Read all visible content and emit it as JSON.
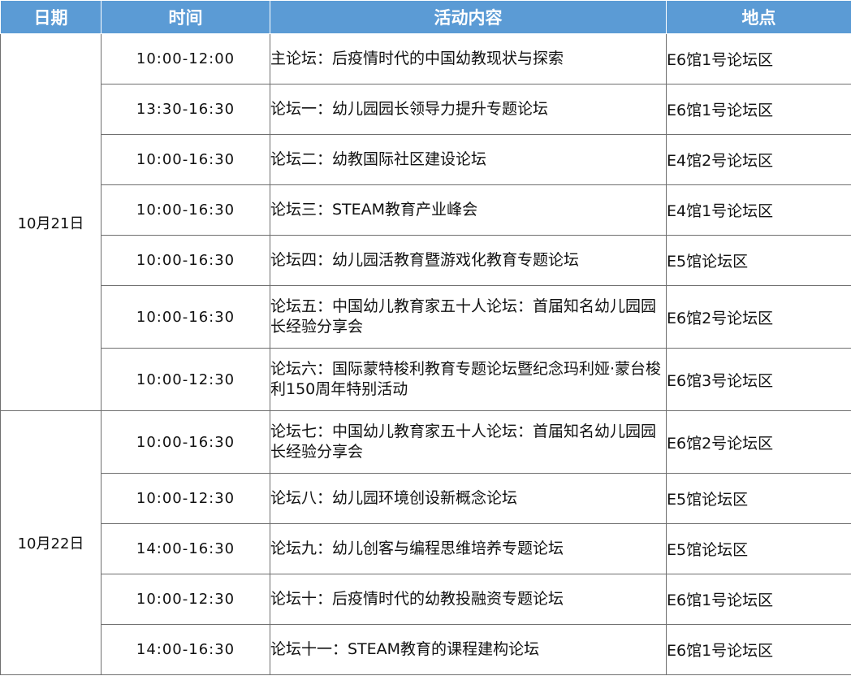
{
  "headers": {
    "date": "日期",
    "time": "时间",
    "activity": "活动内容",
    "location": "地点"
  },
  "days": [
    {
      "date": "10月21日",
      "sessions": [
        {
          "time": "10:00-12:00",
          "activity": "主论坛：后疫情时代的中国幼教现状与探索",
          "location": "E6馆1号论坛区"
        },
        {
          "time": "13:30-16:30",
          "activity": "论坛一：幼儿园园长领导力提升专题论坛",
          "location": "E6馆1号论坛区"
        },
        {
          "time": "10:00-16:30",
          "activity": "论坛二：幼教国际社区建设论坛",
          "location": "E4馆2号论坛区"
        },
        {
          "time": "10:00-16:30",
          "activity": "论坛三：STEAM教育产业峰会",
          "location": "E4馆1号论坛区"
        },
        {
          "time": "10:00-16:30",
          "activity": "论坛四：幼儿园活教育暨游戏化教育专题论坛",
          "location": "E5馆论坛区"
        },
        {
          "time": "10:00-16:30",
          "activity": "论坛五：中国幼儿教育家五十人论坛：首届知名幼儿园园长经验分享会",
          "location": "E6馆2号论坛区"
        },
        {
          "time": "10:00-12:30",
          "activity": "论坛六：国际蒙特梭利教育专题论坛暨纪念玛利娅·蒙台梭利150周年特别活动",
          "location": "E6馆3号论坛区"
        }
      ]
    },
    {
      "date": "10月22日",
      "sessions": [
        {
          "time": "10:00-16:30",
          "activity": "论坛七：中国幼儿教育家五十人论坛：首届知名幼儿园园长经验分享会",
          "location": "E6馆2号论坛区"
        },
        {
          "time": "10:00-12:30",
          "activity": "论坛八：幼儿园环境创设新概念论坛",
          "location": "E5馆论坛区"
        },
        {
          "time": "14:00-16:30",
          "activity": "论坛九：幼儿创客与编程思维培养专题论坛",
          "location": "E5馆论坛区"
        },
        {
          "time": "10:00-12:30",
          "activity": "论坛十：后疫情时代的幼教投融资专题论坛",
          "location": "E6馆1号论坛区"
        },
        {
          "time": "14:00-16:30",
          "activity": "论坛十一：STEAM教育的课程建构论坛",
          "location": "E6馆1号论坛区"
        }
      ]
    }
  ]
}
